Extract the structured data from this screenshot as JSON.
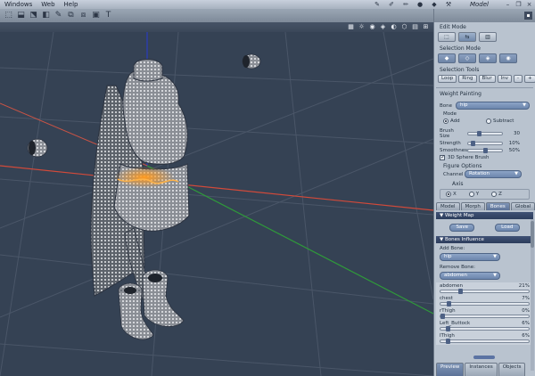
{
  "menu": [
    "Windows",
    "Web",
    "Help"
  ],
  "mode_label": "Model",
  "toolbar_icons": [
    "pen-icon",
    "lasso-icon",
    "cube-icon",
    "grid-icon",
    "brush-icon",
    "move-icon",
    "text-icon"
  ],
  "viewport_controls": [
    "grid-icon",
    "light-icon",
    "cube-icon",
    "sphere-icon",
    "shade-icon",
    "camera-icon"
  ],
  "panel": {
    "edit_mode_title": "Edit Mode",
    "selection_mode_title": "Selection Mode",
    "selection_tools_title": "Selection Tools",
    "selection_tools": [
      "Loop",
      "Ring",
      "Blur",
      "Inv",
      "-",
      "+"
    ],
    "weight_painting_title": "Weight Painting",
    "bone_label": "Bone",
    "bone_value": "hip",
    "mode_label": "Mode",
    "mode_add": "Add",
    "mode_subtract": "Subtract",
    "brush_size_label": "Brush Size",
    "brush_size_value": "30",
    "brush_size_level": 0.3,
    "strength_label": "Strength",
    "strength_value": "10%",
    "strength_level": 0.1,
    "smoothness_label": "Smoothness",
    "smoothness_value": "50%",
    "smoothness_level": 0.5,
    "sphere_brush_label": "3D Sphere Brush",
    "figure_options_title": "Figure Options",
    "channel_label": "Channel",
    "channel_value": "Rotation",
    "axis_title": "Axis",
    "axis_x": "X",
    "axis_y": "Y",
    "axis_z": "Z",
    "tabs": [
      "Model",
      "Morph",
      "Bones",
      "Global"
    ],
    "active_tab": "Bones",
    "weight_map_header": "Weight Map",
    "save_label": "Save",
    "load_label": "Load",
    "bones_influence_header": "Bones Influence",
    "add_bone_label": "Add Bone:",
    "add_bone_value": "hip",
    "remove_bone_label": "Remove Bone:",
    "remove_bone_value": "abdomen",
    "bones": [
      {
        "name": "abdomen",
        "value": "21%",
        "level": 0.21
      },
      {
        "name": "chest",
        "value": "7%",
        "level": 0.07
      },
      {
        "name": "rThigh",
        "value": "0%",
        "level": 0.0
      },
      {
        "name": "Left_Buttock",
        "value": "6%",
        "level": 0.06
      },
      {
        "name": "lThigh",
        "value": "6%",
        "level": 0.06
      }
    ],
    "bottom_tabs": [
      "Preview",
      "Instances",
      "Objects"
    ]
  },
  "colors": {
    "grid_red": "#d24a3a",
    "grid_green": "#2f9a3a",
    "grid_blue": "#2b3cbf",
    "mesh_gray": "#9da0a6",
    "weight_orange": "#e8881e"
  }
}
